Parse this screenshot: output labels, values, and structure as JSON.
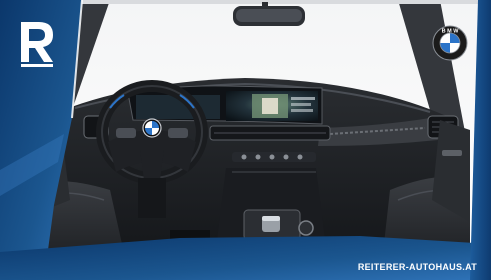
{
  "image": {
    "description_free": true
  },
  "overlay": {
    "dealer_logo_icon": "reiterer-r-logo-icon",
    "brand_badge_icon": "bmw-roundel-icon",
    "website_text": "REITERER-AUTOHAUS.AT"
  },
  "colors": {
    "frame_blue": "#0f3f78",
    "frame_blue_light": "#2f73b8",
    "interior_dark": "#1e2024",
    "accent_white": "#ffffff",
    "bmw_blue": "#2c74c8"
  }
}
